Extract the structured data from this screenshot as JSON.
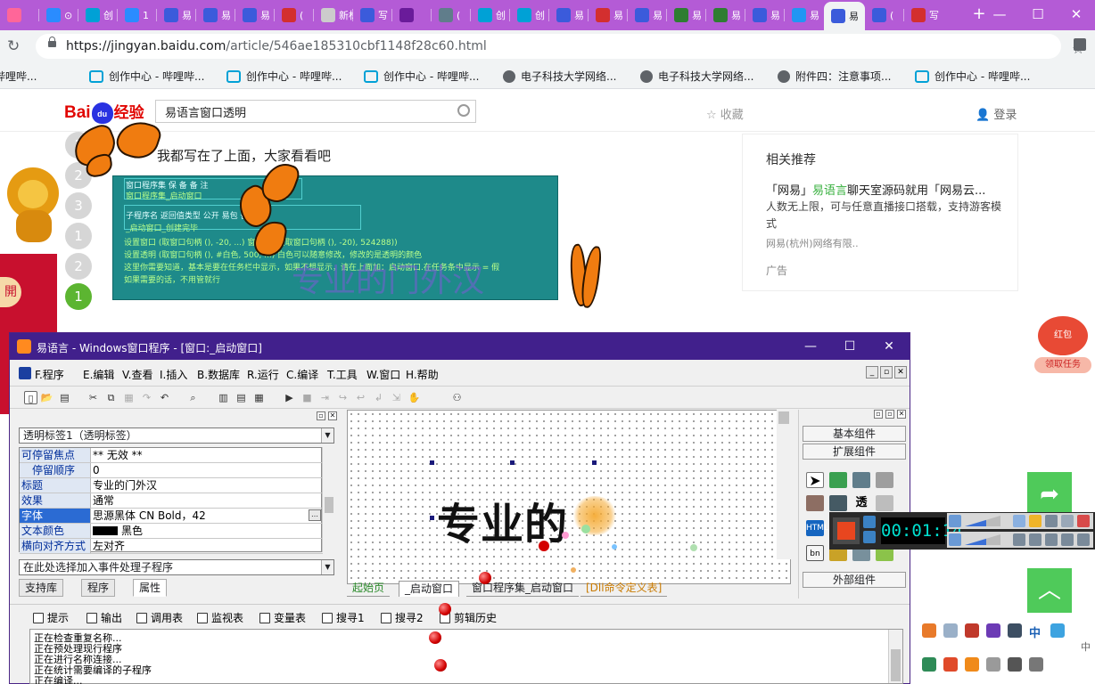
{
  "browser": {
    "tabs": [
      {
        "label": "",
        "color": "#ff6699"
      },
      {
        "label": "⊙",
        "color": "#2a8cff"
      },
      {
        "label": "创",
        "color": "#00a1d6"
      },
      {
        "label": "1",
        "color": "#2a8cff"
      },
      {
        "label": "易",
        "color": "#3b5bdb"
      },
      {
        "label": "易",
        "color": "#3b5bdb"
      },
      {
        "label": "易",
        "color": "#3b5bdb"
      },
      {
        "label": "(",
        "color": "#d32f2f"
      },
      {
        "label": "新标",
        "color": "#cccccc"
      },
      {
        "label": "写",
        "color": "#3b5bdb"
      },
      {
        "label": "",
        "color": "#6a1b9a"
      },
      {
        "label": "(",
        "color": "#607d8b"
      },
      {
        "label": "创",
        "color": "#00a1d6"
      },
      {
        "label": "创",
        "color": "#00a1d6"
      },
      {
        "label": "易",
        "color": "#3b5bdb"
      },
      {
        "label": "易",
        "color": "#d32f2f"
      },
      {
        "label": "易",
        "color": "#3b5bdb"
      },
      {
        "label": "易",
        "color": "#2e7d32"
      },
      {
        "label": "易",
        "color": "#2e7d32"
      },
      {
        "label": "易",
        "color": "#3b5bdb"
      },
      {
        "label": "易",
        "color": "#2196f3"
      },
      {
        "label": "易",
        "color": "#3b5bdb",
        "active": true
      },
      {
        "label": "(",
        "color": "#3b5bdb"
      },
      {
        "label": "写",
        "color": "#d32f2f"
      }
    ],
    "new_tab": "+",
    "window_controls": {
      "minimize": "—",
      "maximize": "☐",
      "close": "✕"
    },
    "url_host": "https://jingyan.baidu.com",
    "url_path": "/article/546ae185310cbf1148f28c60.html",
    "bookmarks": [
      {
        "label": "心 - 哔哩哔...",
        "icon": "bilibili-icon"
      },
      {
        "label": "创作中心 - 哔哩哔...",
        "icon": "bilibili-icon"
      },
      {
        "label": "创作中心 - 哔哩哔...",
        "icon": "bilibili-icon"
      },
      {
        "label": "创作中心 - 哔哩哔...",
        "icon": "bilibili-icon"
      },
      {
        "label": "电子科技大学网络...",
        "icon": "globe-icon"
      },
      {
        "label": "电子科技大学网络...",
        "icon": "globe-icon"
      },
      {
        "label": "附件四：注意事项...",
        "icon": "globe-icon"
      },
      {
        "label": "创作中心 - 哔哩哔...",
        "icon": "bilibili-icon"
      }
    ]
  },
  "baidu": {
    "logo_left": "Bai",
    "logo_paw": "du",
    "logo_right": "经验",
    "search_value": "易语言窗口透明",
    "favorite": "☆ 收藏",
    "login": "登录",
    "steps": [
      "1",
      "2",
      "3",
      "1",
      "2",
      "1"
    ],
    "kai": "開",
    "headline": "我都写在了上面，大家看看吧",
    "image_text": {
      "row1": "窗口程序集    保 备    备 注",
      "row2": "窗口程序集_启动窗口",
      "hdr": "子程序名        返回值类型  公开  易包  备 注",
      "sub": "_启动窗口_创建完毕",
      "l1": "设置窗口 (取窗口句柄 (), -20, ...) 窗口风格 (取窗口句柄 (), -20), 524288))",
      "l2": "设置透明 (取窗口句柄 (), #白色, 500, ...)  白色可以随意修改，修改的是透明的颜色",
      "l3": "这里你需要知道，基本是要在任务栏中显示，如果不想显示，请在上面加：启动窗口.在任务条中显示 = 假",
      "l4": "如果需要的话，不用管就行",
      "overlay": "专业的门外汉"
    },
    "related": {
      "title": "相关推荐",
      "item_title_a": "「网易」",
      "item_title_hl": "易语言",
      "item_title_b": "聊天室源码就用「网易云...",
      "item_desc": "人数无上限，可与任意直播接口搭载，支持游客模式",
      "item_source": "网易(杭州)网络有限..",
      "ad": "广告"
    },
    "hongbao": {
      "top": "红包",
      "button": "领取任务"
    }
  },
  "ide": {
    "title": "易语言 - Windows窗口程序 - [窗口:_启动窗口]",
    "window_controls": {
      "minimize": "—",
      "maximize": "☐",
      "close": "✕"
    },
    "menu": [
      "F.程序",
      "E.编辑",
      "V.查看",
      "I.插入",
      "B.数据库",
      "R.运行",
      "C.编译",
      "T.工具",
      "W.窗口",
      "H.帮助"
    ],
    "component_selector": "透明标签1（透明标签）",
    "properties": [
      {
        "key": "可停留焦点",
        "value": "** 无效 **"
      },
      {
        "key": "停留顺序",
        "value": "0",
        "indent": true
      },
      {
        "key": "标题",
        "value": "专业的门外汉"
      },
      {
        "key": "效果",
        "value": "通常"
      },
      {
        "key": "字体",
        "value": "思源黑体 CN Bold，42",
        "selected": true
      },
      {
        "key": "文本颜色",
        "value": "黑色"
      },
      {
        "key": "横向对齐方式",
        "value": "左对齐"
      }
    ],
    "event_selector": "在此处选择加入事件处理子程序",
    "left_tabs": [
      "支持库",
      "程序",
      "属性"
    ],
    "designer_label": "专业的",
    "designer_tabs": [
      "起始页",
      "_启动窗口",
      "窗口程序集_启动窗口",
      "[Dll命令定义表]"
    ],
    "palette": [
      "基本组件",
      "扩展组件",
      "外部组件"
    ],
    "output_tabs": [
      "提示",
      "输出",
      "调用表",
      "监视表",
      "变量表",
      "搜寻1",
      "搜寻2",
      "剪辑历史"
    ],
    "log": [
      "正在检查重复名称...",
      "正在预处理现行程序",
      "正在进行名称连接...",
      "正在统计需要编译的子程序",
      "正在编译..."
    ]
  },
  "recorder": {
    "time": "00:01:14"
  },
  "tray": {
    "ime": "中",
    "ime_small": "中"
  }
}
